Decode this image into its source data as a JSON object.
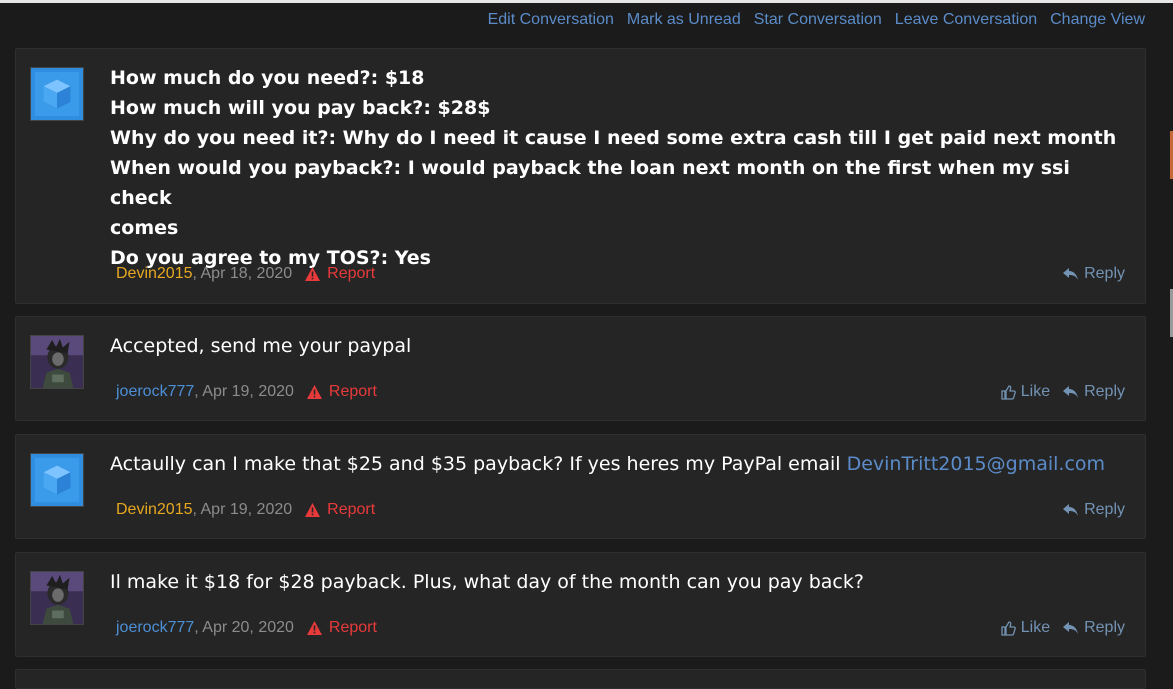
{
  "conversation_actions": {
    "edit": "Edit Conversation",
    "mark_unread": "Mark as Unread",
    "star": "Star Conversation",
    "leave": "Leave Conversation",
    "change_view": "Change View"
  },
  "messages": [
    {
      "lines": [
        "How much do you need?: $18",
        "How much will you pay back?: $28$",
        "Why do you need it?: Why do I need it cause I need some extra cash till I get paid next month",
        "When would you payback?: I would payback the loan next month on the first when my ssi check",
        "comes",
        "Do you agree to my TOS?: Yes"
      ],
      "author": "Devin2015",
      "date": ", Apr 18, 2020",
      "report": "Report",
      "reply": "Reply"
    },
    {
      "text": "Accepted, send me your paypal",
      "author": "joerock777",
      "date": ", Apr 19, 2020",
      "report": "Report",
      "like": "Like",
      "reply": "Reply"
    },
    {
      "text": "Actaully can I make that $25 and $35 payback? If yes heres my PayPal email ",
      "email": "DevinTritt2015@gmail.com",
      "author": "Devin2015",
      "date": ", Apr 19, 2020",
      "report": "Report",
      "reply": "Reply"
    },
    {
      "text": "Il make it $18 for $28 payback. Plus, what day of the month can you pay back?",
      "author": "joerock777",
      "date": ", Apr 20, 2020",
      "report": "Report",
      "like": "Like",
      "reply": "Reply"
    }
  ],
  "colors": {
    "background": "#1b1b1b",
    "panel": "#252525",
    "link": "#5b8cc9",
    "author_orange": "#e7a821",
    "author_blue": "#4c8fd6",
    "report_red": "#e83a3a",
    "action_blue": "#7393b4"
  },
  "icons": {
    "avatar_devin": "blue-cube-avatar",
    "avatar_joe": "character-avatar",
    "report": "warning-triangle-icon",
    "reply": "reply-arrow-icon",
    "like": "thumbs-up-icon"
  }
}
